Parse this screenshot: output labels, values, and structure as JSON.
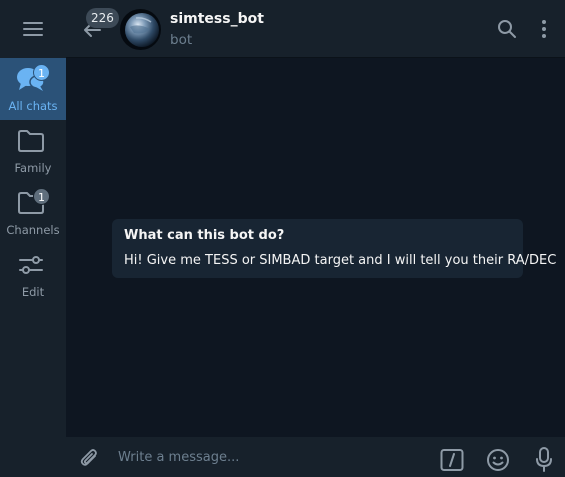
{
  "sidebar": {
    "menu_icon": "hamburger-menu-icon",
    "folders": [
      {
        "label": "All chats",
        "icon": "chats-bubble-icon",
        "badge": "1",
        "active": true
      },
      {
        "label": "Family",
        "icon": "folder-icon",
        "badge": "",
        "active": false
      },
      {
        "label": "Channels",
        "icon": "folder-icon",
        "badge": "1",
        "active": false
      },
      {
        "label": "Edit",
        "icon": "sliders-edit-icon",
        "badge": "",
        "active": false
      }
    ]
  },
  "header": {
    "unread_count": "226",
    "chat_title": "simtess_bot",
    "chat_subtitle": "bot",
    "back_icon": "arrow-left-icon",
    "search_icon": "search-icon",
    "more_icon": "more-vertical-icon"
  },
  "bot_info": {
    "title": "What can this bot do?",
    "description": "Hi! Give me TESS or SIMBAD target and I will tell you their RA/DEC"
  },
  "composer": {
    "placeholder": "Write a message...",
    "attach_icon": "paperclip-icon",
    "command_icon": "bot-command-icon",
    "emoji_icon": "emoji-icon",
    "mic_icon": "microphone-icon"
  },
  "colors": {
    "background": "#0e1621",
    "panel": "#17212b",
    "active_folder": "#2b5278",
    "accent": "#6ab3f3",
    "card": "#182533"
  }
}
